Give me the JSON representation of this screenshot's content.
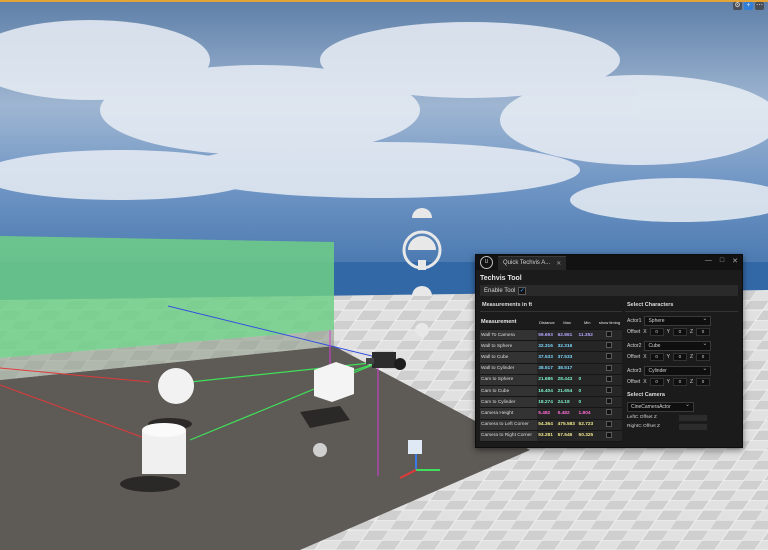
{
  "toolbar": {
    "icons": [
      "settings-icon",
      "add-icon",
      "more-icon"
    ]
  },
  "panel": {
    "tab_title": "Quick Techvis A...",
    "tab_close": "✕",
    "window_buttons": [
      "—",
      "□",
      "✕"
    ],
    "heading": "Techvis Tool",
    "enable_label": "Enable Tool",
    "measurements_title": "Measurements in ft",
    "columns": {
      "measurement": "Measurement",
      "distance": "Distance",
      "max": "Max",
      "min": "Min",
      "show": "show timing"
    },
    "rows": [
      {
        "label": "Wall To Camera",
        "distance": "59.693",
        "max": "62.861",
        "min": "11.352",
        "color": "#b4a6ff"
      },
      {
        "label": "Wall to  Sphere",
        "distance": "32.316",
        "max": "32.316",
        "min": "",
        "color": "#7ad7ff"
      },
      {
        "label": "Wall to  Cube",
        "distance": "37.533",
        "max": "37.533",
        "min": "",
        "color": "#7ad7ff"
      },
      {
        "label": "Wall to Cylinder",
        "distance": "38.517",
        "max": "38.517",
        "min": "",
        "color": "#7ad7ff"
      },
      {
        "label": "Cam to  Sphere",
        "distance": "21.686",
        "max": "28.443",
        "min": "0",
        "color": "#7cf0c8"
      },
      {
        "label": "Cam to Cube",
        "distance": "16.404",
        "max": "21.654",
        "min": "0",
        "color": "#7cf0c8"
      },
      {
        "label": "Cam to  Cylinder",
        "distance": "18.274",
        "max": "24.18",
        "min": "0",
        "color": "#7cf0c8"
      },
      {
        "label": "Camera Height",
        "distance": "5.482",
        "max": "5.482",
        "min": "1.804",
        "color": "#ff6ad5"
      },
      {
        "label": "Camera to Left Corner",
        "distance": "54.364",
        "max": "475.583",
        "min": "52.723",
        "color": "#f0e68c"
      },
      {
        "label": "Camera to Right Corner",
        "distance": "53.281",
        "max": "57.546",
        "min": "50.325",
        "color": "#f0e68c"
      }
    ],
    "characters_title": "Select Characters",
    "actors": [
      {
        "label": "Actor1",
        "value": "Sphere",
        "offset_label": "Offset",
        "x": "0",
        "y": "0",
        "z": "0"
      },
      {
        "label": "Actor2",
        "value": "Cube",
        "offset_label": "Offset",
        "x": "0",
        "y": "0",
        "z": "0"
      },
      {
        "label": "Actor3",
        "value": "Cylinder",
        "offset_label": "Offset",
        "x": "0",
        "y": "0",
        "z": "0"
      }
    ],
    "axis": {
      "x": "X",
      "y": "Y",
      "z": "Z"
    },
    "camera_title": "Select Camera",
    "camera_value": "CineCameraActor",
    "left_offset_label": "LeftC Offset Z",
    "right_offset_label": "RightC Offset Z"
  }
}
